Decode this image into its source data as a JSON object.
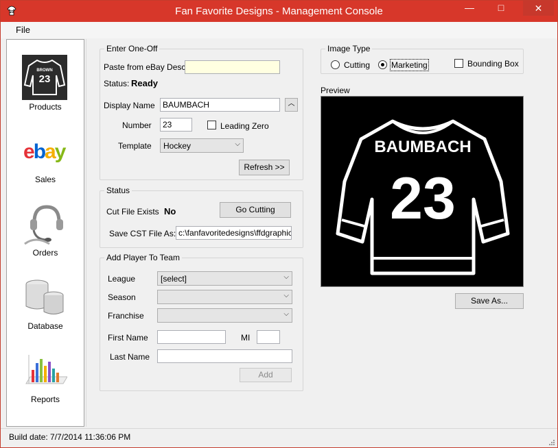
{
  "window": {
    "title": "Fan Favorite Designs - Management Console",
    "minimize": "—",
    "maximize": "□",
    "close": "✕"
  },
  "menu": {
    "file": "File"
  },
  "nav": {
    "items": [
      {
        "label": "Products",
        "icon": "jersey-icon"
      },
      {
        "label": "Sales",
        "icon": "ebay-logo-icon"
      },
      {
        "label": "Orders",
        "icon": "headset-icon"
      },
      {
        "label": "Database",
        "icon": "database-icon"
      },
      {
        "label": "Reports",
        "icon": "chart-icon"
      }
    ],
    "jersey_icon_name": "BROWN",
    "jersey_icon_number": "23"
  },
  "one_off": {
    "title": "Enter One-Off",
    "paste_label": "Paste from eBay Desc",
    "paste_value": "",
    "status_label": "Status:",
    "status_value": "Ready",
    "display_name_label": "Display Name",
    "display_name_value": "BAUMBACH",
    "number_label": "Number",
    "number_value": "23",
    "leading_zero_label": "Leading Zero",
    "leading_zero_checked": false,
    "template_label": "Template",
    "template_value": "Hockey",
    "refresh_label": "Refresh >>"
  },
  "status_group": {
    "title": "Status",
    "cut_file_label": "Cut File Exists",
    "cut_file_value": "No",
    "go_cutting_label": "Go Cutting",
    "save_cst_label": "Save CST File As:",
    "save_cst_value": "c:\\fanfavoritedesigns\\ffdgraphics\\"
  },
  "add_player": {
    "title": "Add Player To Team",
    "league_label": "League",
    "league_value": "[select]",
    "season_label": "Season",
    "season_value": "",
    "franchise_label": "Franchise",
    "franchise_value": "",
    "first_name_label": "First Name",
    "first_name_value": "",
    "mi_label": "MI",
    "mi_value": "",
    "last_name_label": "Last Name",
    "last_name_value": "",
    "add_label": "Add"
  },
  "image_type": {
    "title": "Image Type",
    "cutting_label": "Cutting",
    "marketing_label": "Marketing",
    "selected": "Marketing",
    "bounding_box_label": "Bounding Box",
    "bounding_box_checked": false
  },
  "preview": {
    "label": "Preview",
    "jersey_name": "BAUMBACH",
    "jersey_number": "23",
    "save_as_label": "Save As..."
  },
  "statusbar": {
    "build": "Build date: 7/7/2014 11:36:06 PM"
  },
  "colors": {
    "titlebar": "#d7372a",
    "preview_bg": "#000000"
  }
}
